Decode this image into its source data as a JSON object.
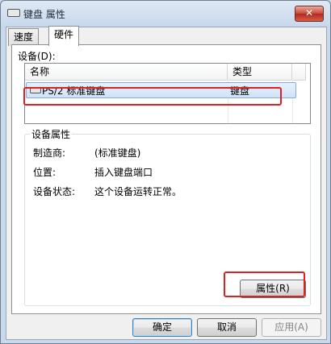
{
  "window": {
    "title": "键盘 属性",
    "close_glyph": "✕"
  },
  "tabs": [
    {
      "label": "速度"
    },
    {
      "label": "硬件"
    }
  ],
  "devices": {
    "label": "设备(D):",
    "columns": {
      "name": "名称",
      "type": "类型"
    },
    "rows": [
      {
        "name": "PS/2 标准键盘",
        "type": "键盘",
        "icon": "keyboard-icon"
      }
    ]
  },
  "device_properties": {
    "title": "设备属性",
    "items": [
      {
        "key": "制造商:",
        "value": "(标准键盘)"
      },
      {
        "key": "位置:",
        "value": "插入键盘端口"
      },
      {
        "key": "设备状态:",
        "value": "这个设备运转正常。"
      }
    ],
    "button": "属性(R)"
  },
  "footer": {
    "ok": "确定",
    "cancel": "取消",
    "apply": "应用(A)"
  },
  "colors": {
    "highlight": "#e02020",
    "selection": "#cfe3f8",
    "titlebar": "#c9d9ec"
  }
}
